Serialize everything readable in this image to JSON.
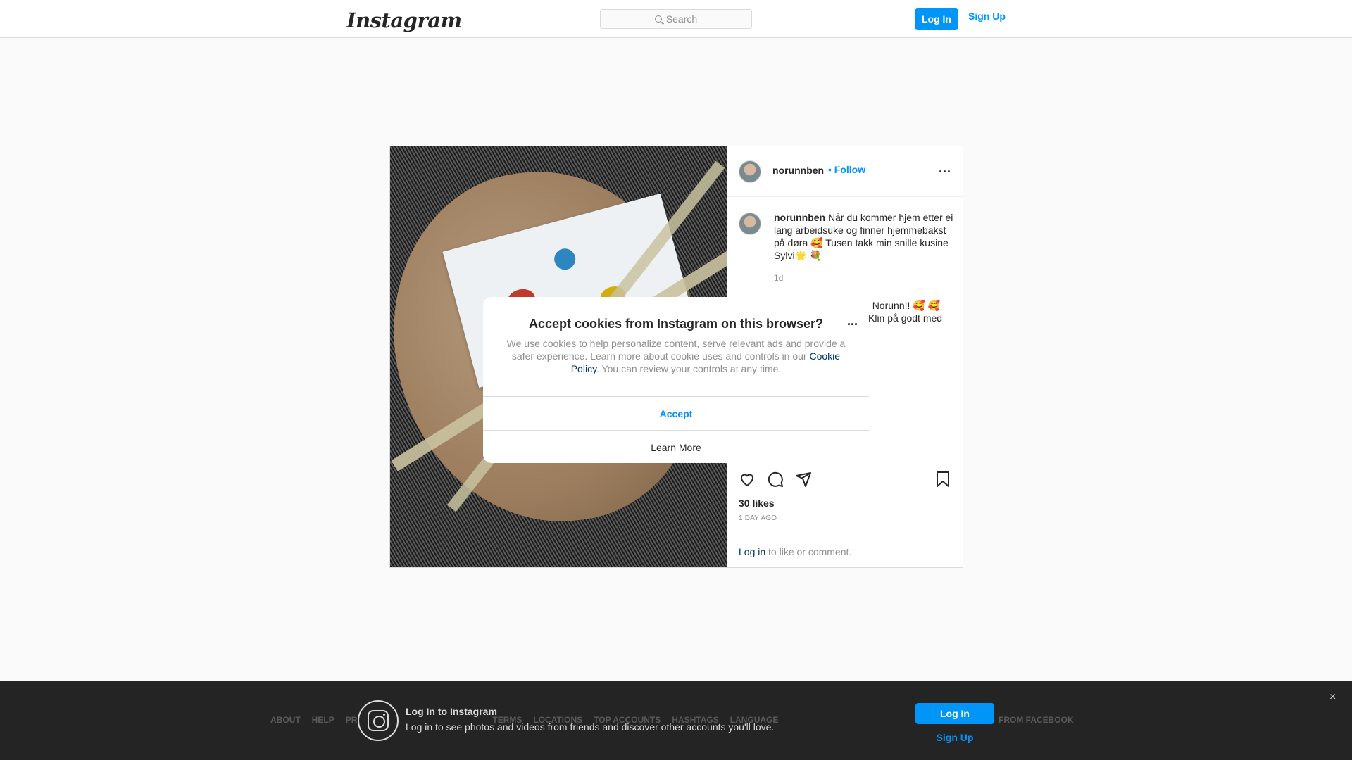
{
  "header": {
    "logo": "Instagram",
    "search_placeholder": "Search",
    "login": "Log In",
    "signup": "Sign Up"
  },
  "post": {
    "username": "norunnben",
    "follow": "• Follow",
    "more": "...",
    "caption_user": "norunnben",
    "caption_text": " Når du kommer hjem etter ei lang arbeidsuke og finner hjemmebakst på døra 🥰 Tusen takk min snille kusine Sylvi🌟 💐",
    "caption_time": "1d",
    "comment_visible_1": "er du, Norunn!! 🥰 🥰",
    "comment_visible_2": "Klin på godt med",
    "likes": "30 likes",
    "posted": "1 DAY AGO",
    "login_link": "Log in",
    "login_rest": " to like or comment."
  },
  "cookie_modal": {
    "title": "Accept cookies from Instagram on this browser?",
    "more": "...",
    "body_before": "We use cookies to help personalize content, serve relevant ads and provide a safer experience. Learn more about cookie uses and controls in our ",
    "policy_link": "Cookie Policy",
    "body_after": ". You can review your controls at any time.",
    "accept": "Accept",
    "learn_more": "Learn More"
  },
  "banner": {
    "title": "Log In to Instagram",
    "subtitle": "Log in to see photos and videos from friends and discover other accounts you'll love.",
    "login": "Log In",
    "signup": "Sign Up",
    "close": "×",
    "footer_links": [
      "About",
      "Help",
      "Pr",
      "",
      "",
      "Terms",
      "Locations",
      "Top Accounts",
      "Hashtags",
      "Language"
    ],
    "copyright": "FROM FACEBOOK"
  }
}
